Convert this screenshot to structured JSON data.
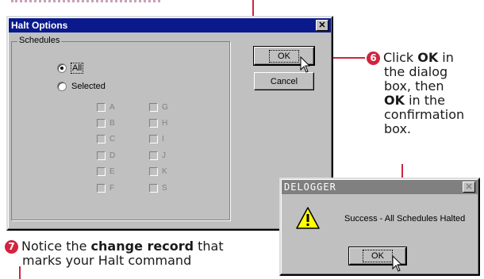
{
  "halt_dialog": {
    "title": "Halt Options",
    "close_glyph": "✕",
    "group_label": "Schedules",
    "radio_all": "All",
    "radio_selected": "Selected",
    "schedules_left": [
      "A",
      "B",
      "C",
      "D",
      "E",
      "F"
    ],
    "schedules_right": [
      "G",
      "H",
      "I",
      "J",
      "K",
      "S"
    ],
    "ok_label": "OK",
    "cancel_label": "Cancel"
  },
  "confirm_dialog": {
    "title": "DELOGGER",
    "close_glyph": "✕",
    "message": "Success - All Schedules Halted",
    "ok_label": "OK",
    "icon": "warning-icon"
  },
  "callouts": {
    "step6_number": "6",
    "step6_line1_pre": "Click ",
    "step6_line1_bold": "OK",
    "step6_line1_post": " in",
    "step6_line2": "the dialog",
    "step6_line3": "box, then",
    "step6_line4_bold": "OK",
    "step6_line4_post": " in the",
    "step6_line5": "confirmation",
    "step6_line6": "box.",
    "step7_number": "7",
    "step7_line1_pre": "Notice the ",
    "step7_line1_bold": "change record",
    "step7_line1_post": " that",
    "step7_line2": "marks your Halt command"
  },
  "colors": {
    "accent": "#d0243f",
    "titlebar_active": "#0a1a8c",
    "titlebar_inactive": "#808080",
    "dialog_face": "#c0c0c0"
  }
}
